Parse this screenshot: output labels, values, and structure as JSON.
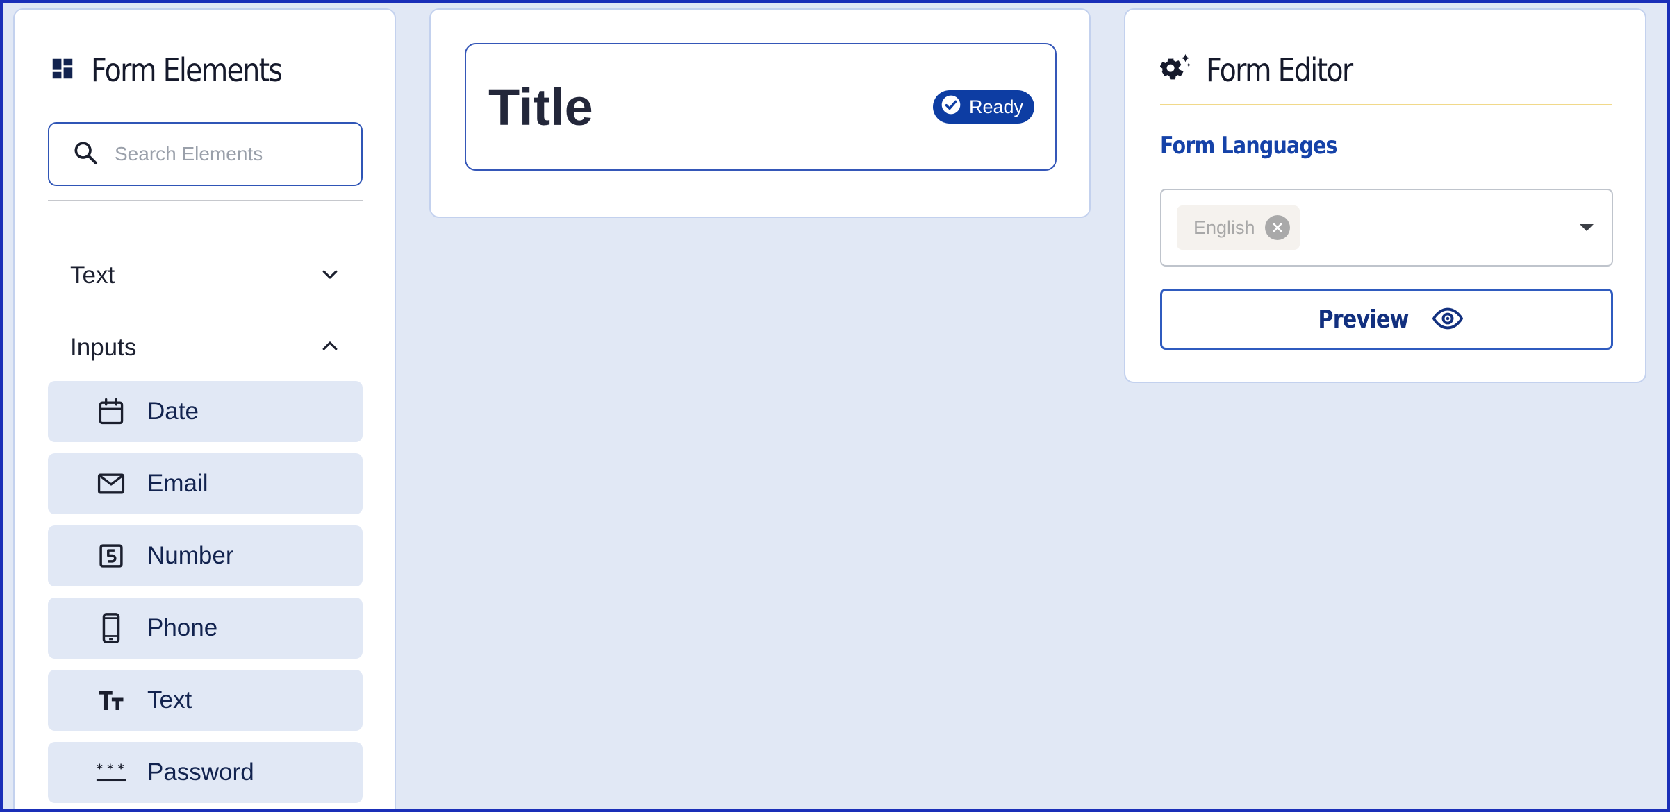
{
  "elements_panel": {
    "title": "Form Elements",
    "title_icon": "dashboard-icon",
    "search": {
      "placeholder": "Search Elements",
      "value": ""
    },
    "sections": [
      {
        "label": "Text",
        "expanded": false,
        "chevron": "chevron-down-icon"
      },
      {
        "label": "Inputs",
        "expanded": true,
        "chevron": "chevron-up-icon"
      }
    ],
    "input_items": [
      {
        "label": "Date",
        "icon": "calendar-icon"
      },
      {
        "label": "Email",
        "icon": "envelope-icon"
      },
      {
        "label": "Number",
        "icon": "number-five-box-icon"
      },
      {
        "label": "Phone",
        "icon": "mobile-phone-icon"
      },
      {
        "label": "Text",
        "icon": "text-size-icon"
      },
      {
        "label": "Password",
        "icon": "password-asterisks-icon"
      }
    ]
  },
  "canvas": {
    "title": "Title",
    "status": {
      "label": "Ready",
      "icon": "check-circle-icon"
    }
  },
  "editor_panel": {
    "title": "Form Editor",
    "title_icon": "settings-sparkle-icon",
    "languages_label": "Form Languages",
    "languages": [
      "English"
    ],
    "preview_label": "Preview",
    "preview_icon": "eye-icon"
  },
  "colors": {
    "background": "#e1e8f5",
    "accent": "#0d3da3",
    "border": "#c3d1ee",
    "divider_gold": "#f1d98a",
    "frame": "#1a2fb8"
  }
}
